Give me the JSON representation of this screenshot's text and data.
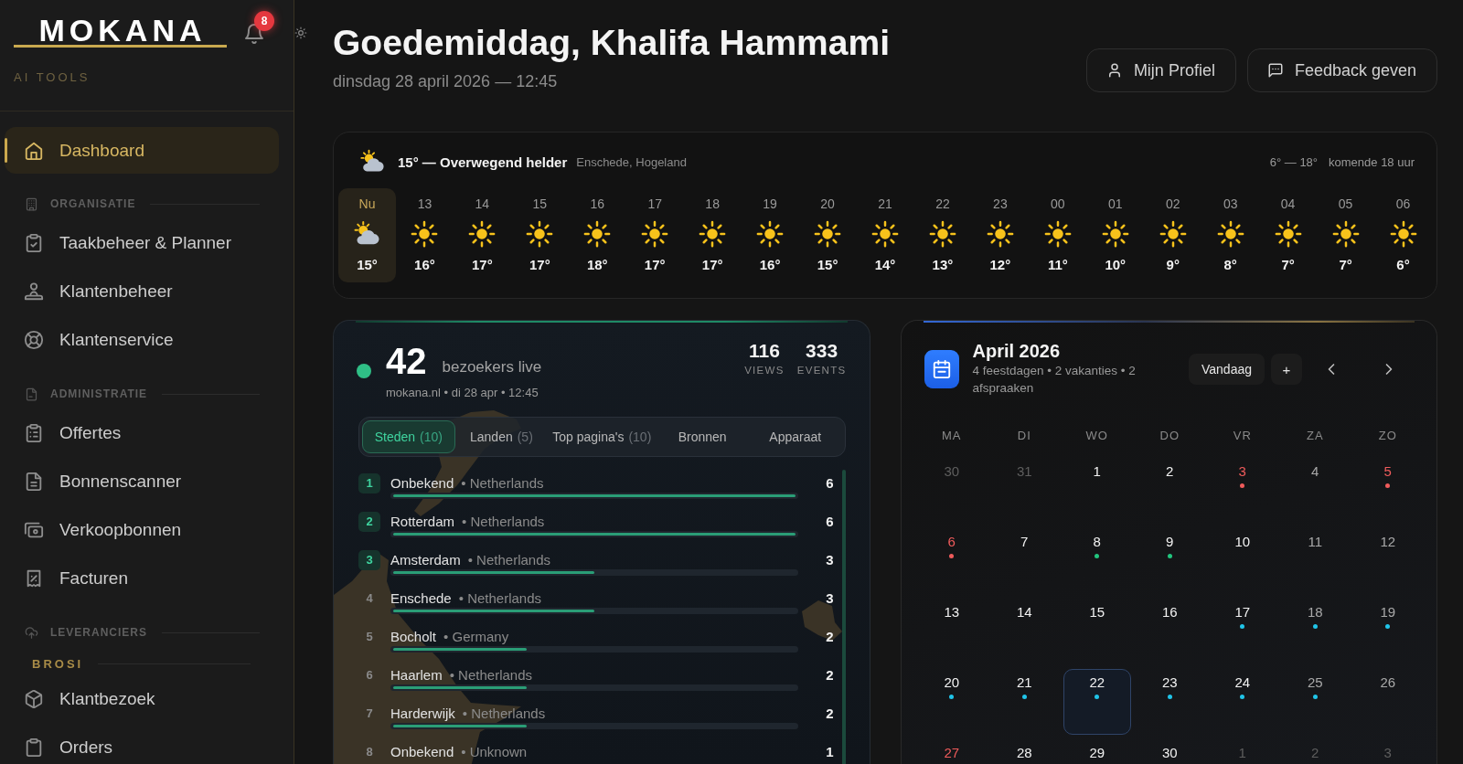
{
  "sidebar": {
    "logo": "MOKANA",
    "tagline": "AI TOOLS",
    "notification_count": "8",
    "items": [
      {
        "label": "Dashboard",
        "selected": true
      }
    ],
    "sections": [
      {
        "title": "ORGANISATIE",
        "items": [
          {
            "label": "Taakbeheer & Planner",
            "selected": false
          },
          {
            "label": "Klantenbeheer",
            "selected": false
          },
          {
            "label": "Klantenservice",
            "selected": false
          }
        ]
      },
      {
        "title": "ADMINISTRATIE",
        "items": [
          {
            "label": "Offertes",
            "selected": false
          },
          {
            "label": "Bonnenscanner",
            "selected": false
          },
          {
            "label": "Verkoopbonnen",
            "selected": false
          },
          {
            "label": "Facturen",
            "selected": false
          }
        ]
      },
      {
        "title": "LEVERANCIERS",
        "groups": [
          {
            "title": "BROSI",
            "items": [
              {
                "label": "Klantbezoek",
                "selected": false
              },
              {
                "label": "Orders",
                "selected": false
              }
            ]
          }
        ]
      }
    ]
  },
  "header": {
    "greeting": "Goedemiddag, Khalifa Hammami",
    "date": "dinsdag 28 april 2026 — 12:45",
    "buttons": [
      "Mijn Profiel",
      "Feedback geven"
    ]
  },
  "weather": {
    "kind": "partly-cloudy",
    "summary": "15° — Overwegend helder",
    "location": "Enschede, Hogeland",
    "range": "6° — 18°",
    "period": "komende 18 uur",
    "hours": [
      {
        "time": "Nu",
        "kind": "partly-cloudy",
        "temp": "15°",
        "current": true
      },
      {
        "time": "13",
        "kind": "sunny",
        "temp": "16°",
        "current": false
      },
      {
        "time": "14",
        "kind": "sunny",
        "temp": "17°",
        "current": false
      },
      {
        "time": "15",
        "kind": "sunny",
        "temp": "17°",
        "current": false
      },
      {
        "time": "16",
        "kind": "sunny",
        "temp": "18°",
        "current": false
      },
      {
        "time": "17",
        "kind": "sunny",
        "temp": "17°",
        "current": false
      },
      {
        "time": "18",
        "kind": "sunny",
        "temp": "17°",
        "current": false
      },
      {
        "time": "19",
        "kind": "sunny",
        "temp": "16°",
        "current": false
      },
      {
        "time": "20",
        "kind": "sunny",
        "temp": "15°",
        "current": false
      },
      {
        "time": "21",
        "kind": "sunny",
        "temp": "14°",
        "current": false
      },
      {
        "time": "22",
        "kind": "sunny",
        "temp": "13°",
        "current": false
      },
      {
        "time": "23",
        "kind": "sunny",
        "temp": "12°",
        "current": false
      },
      {
        "time": "00",
        "kind": "sunny",
        "temp": "11°",
        "current": false
      },
      {
        "time": "01",
        "kind": "sunny",
        "temp": "10°",
        "current": false
      },
      {
        "time": "02",
        "kind": "sunny",
        "temp": "9°",
        "current": false
      },
      {
        "time": "03",
        "kind": "sunny",
        "temp": "8°",
        "current": false
      },
      {
        "time": "04",
        "kind": "sunny",
        "temp": "7°",
        "current": false
      },
      {
        "time": "05",
        "kind": "sunny",
        "temp": "7°",
        "current": false
      },
      {
        "time": "06",
        "kind": "sunny",
        "temp": "6°",
        "current": false
      }
    ]
  },
  "visitors": {
    "live_count": "42",
    "live_label": "bezoekers live",
    "meta": "mokana.nl • di 28 apr • 12:45",
    "stats": [
      {
        "value": "116",
        "label": "VIEWS"
      },
      {
        "value": "333",
        "label": "EVENTS"
      }
    ],
    "tabs": [
      {
        "label": "Steden",
        "count": "(10)",
        "selected": true
      },
      {
        "label": "Landen",
        "count": "(5)",
        "selected": false
      },
      {
        "label": "Top pagina's",
        "count": "(10)",
        "selected": false
      },
      {
        "label": "Bronnen",
        "selected": false
      },
      {
        "label": "Apparaat",
        "selected": false
      }
    ],
    "rows": [
      {
        "rank": "1",
        "city": "Onbekend",
        "country": "• Netherlands",
        "count": "6",
        "level": 1,
        "top": true
      },
      {
        "rank": "2",
        "city": "Rotterdam",
        "country": "• Netherlands",
        "count": "6",
        "level": 1,
        "top": true
      },
      {
        "rank": "3",
        "city": "Amsterdam",
        "country": "• Netherlands",
        "count": "3",
        "level": 0.5,
        "top": true
      },
      {
        "rank": "4",
        "city": "Enschede",
        "country": "• Netherlands",
        "count": "3",
        "level": 0.5,
        "top": false
      },
      {
        "rank": "5",
        "city": "Bocholt",
        "country": "• Germany",
        "count": "2",
        "level": 0.333,
        "top": false
      },
      {
        "rank": "6",
        "city": "Haarlem",
        "country": "• Netherlands",
        "count": "2",
        "level": 0.333,
        "top": false
      },
      {
        "rank": "7",
        "city": "Harderwijk",
        "country": "• Netherlands",
        "count": "2",
        "level": 0.333,
        "top": false
      },
      {
        "rank": "8",
        "city": "Onbekend",
        "country": "• Unknown",
        "count": "1",
        "top": false
      }
    ]
  },
  "calendar": {
    "title": "April 2026",
    "summary": "4 feestdagen • 2 vakanties • 2 afspraaken",
    "today_button": "Vandaag",
    "add_button": "+",
    "weekdays": [
      "MA",
      "DI",
      "WO",
      "DO",
      "VR",
      "ZA",
      "ZO"
    ],
    "days": [
      {
        "label": "30",
        "outside": true,
        "holiday": false,
        "selected": false
      },
      {
        "label": "31",
        "outside": true,
        "holiday": false,
        "selected": false
      },
      {
        "label": "1",
        "outside": false,
        "holiday": false,
        "selected": false
      },
      {
        "label": "2",
        "outside": false,
        "holiday": false,
        "selected": false
      },
      {
        "label": "3",
        "outside": false,
        "holiday": true,
        "selected": false,
        "color": "#ef5b5b"
      },
      {
        "label": "4",
        "outside": false,
        "holiday": false,
        "selected": false
      },
      {
        "label": "5",
        "outside": false,
        "holiday": true,
        "selected": false,
        "color": "#ef5b5b"
      },
      {
        "label": "6",
        "outside": false,
        "holiday": true,
        "selected": false,
        "color": "#ef5b5b"
      },
      {
        "label": "7",
        "outside": false,
        "holiday": false,
        "selected": false
      },
      {
        "label": "8",
        "outside": false,
        "holiday": false,
        "selected": false,
        "color": "#22c57e"
      },
      {
        "label": "9",
        "outside": false,
        "holiday": false,
        "selected": false,
        "color": "#22c57e"
      },
      {
        "label": "10",
        "outside": false,
        "holiday": false,
        "selected": false
      },
      {
        "label": "11",
        "outside": false,
        "holiday": false,
        "selected": false
      },
      {
        "label": "12",
        "outside": false,
        "holiday": false,
        "selected": false
      },
      {
        "label": "13",
        "outside": false,
        "holiday": false,
        "selected": false
      },
      {
        "label": "14",
        "outside": false,
        "holiday": false,
        "selected": false
      },
      {
        "label": "15",
        "outside": false,
        "holiday": false,
        "selected": false
      },
      {
        "label": "16",
        "outside": false,
        "holiday": false,
        "selected": false
      },
      {
        "label": "17",
        "outside": false,
        "holiday": false,
        "selected": false,
        "color": "#20c4e8"
      },
      {
        "label": "18",
        "outside": false,
        "holiday": false,
        "selected": false,
        "color": "#20c4e8"
      },
      {
        "label": "19",
        "outside": false,
        "holiday": false,
        "selected": false,
        "color": "#20c4e8"
      },
      {
        "label": "20",
        "outside": false,
        "holiday": false,
        "selected": false,
        "color": "#20c4e8"
      },
      {
        "label": "21",
        "outside": false,
        "holiday": false,
        "selected": false,
        "color": "#20c4e8"
      },
      {
        "label": "22",
        "outside": false,
        "holiday": false,
        "selected": true,
        "color": "#20c4e8"
      },
      {
        "label": "23",
        "outside": false,
        "holiday": false,
        "selected": false,
        "color": "#20c4e8"
      },
      {
        "label": "24",
        "outside": false,
        "holiday": false,
        "selected": false,
        "color": "#20c4e8"
      },
      {
        "label": "25",
        "outside": false,
        "holiday": false,
        "selected": false,
        "color": "#20c4e8"
      },
      {
        "label": "26",
        "outside": false,
        "holiday": false,
        "selected": false
      },
      {
        "label": "27",
        "outside": false,
        "holiday": true,
        "selected": false
      },
      {
        "label": "28",
        "outside": false,
        "holiday": false,
        "selected": false
      },
      {
        "label": "29",
        "outside": false,
        "holiday": false,
        "selected": false
      },
      {
        "label": "30",
        "outside": false,
        "holiday": false,
        "selected": false
      },
      {
        "label": "1",
        "outside": true,
        "holiday": false,
        "selected": false
      },
      {
        "label": "2",
        "outside": true,
        "holiday": false,
        "selected": false
      },
      {
        "label": "3",
        "outside": true,
        "holiday": false,
        "selected": false
      }
    ]
  }
}
